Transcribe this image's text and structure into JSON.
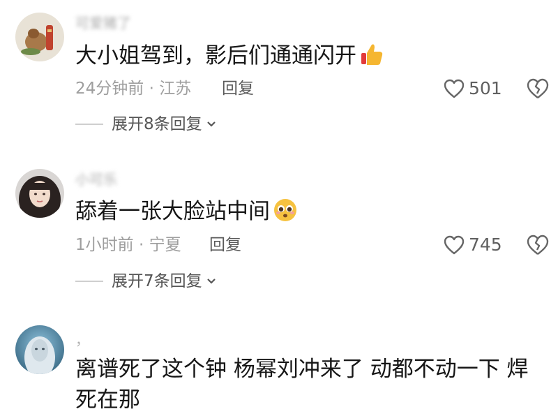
{
  "comments": [
    {
      "username": "可爱猪了",
      "text": "大小姐驾到，影后们通通闪开",
      "emoji": "thumbs-up-emoji",
      "time": "24分钟前",
      "location": "江苏",
      "meta": "24分钟前 · 江苏",
      "reply_label": "回复",
      "likes": "501",
      "expand_label": "展开8条回复"
    },
    {
      "username": "小可乐",
      "text": "舔着一张大脸站中间",
      "emoji": "pleading-face-emoji",
      "time": "1小时前",
      "location": "宁夏",
      "meta": "1小时前 · 宁夏",
      "reply_label": "回复",
      "likes": "745",
      "expand_label": "展开7条回复"
    },
    {
      "username": "，",
      "text": "离谱死了这个钟 杨幂刘冲来了 动都不动一下 焊死在那"
    }
  ],
  "colors": {
    "text": "#161616",
    "meta": "#9e9e9e",
    "username": "#a9a9a9",
    "icon": "#666666"
  }
}
